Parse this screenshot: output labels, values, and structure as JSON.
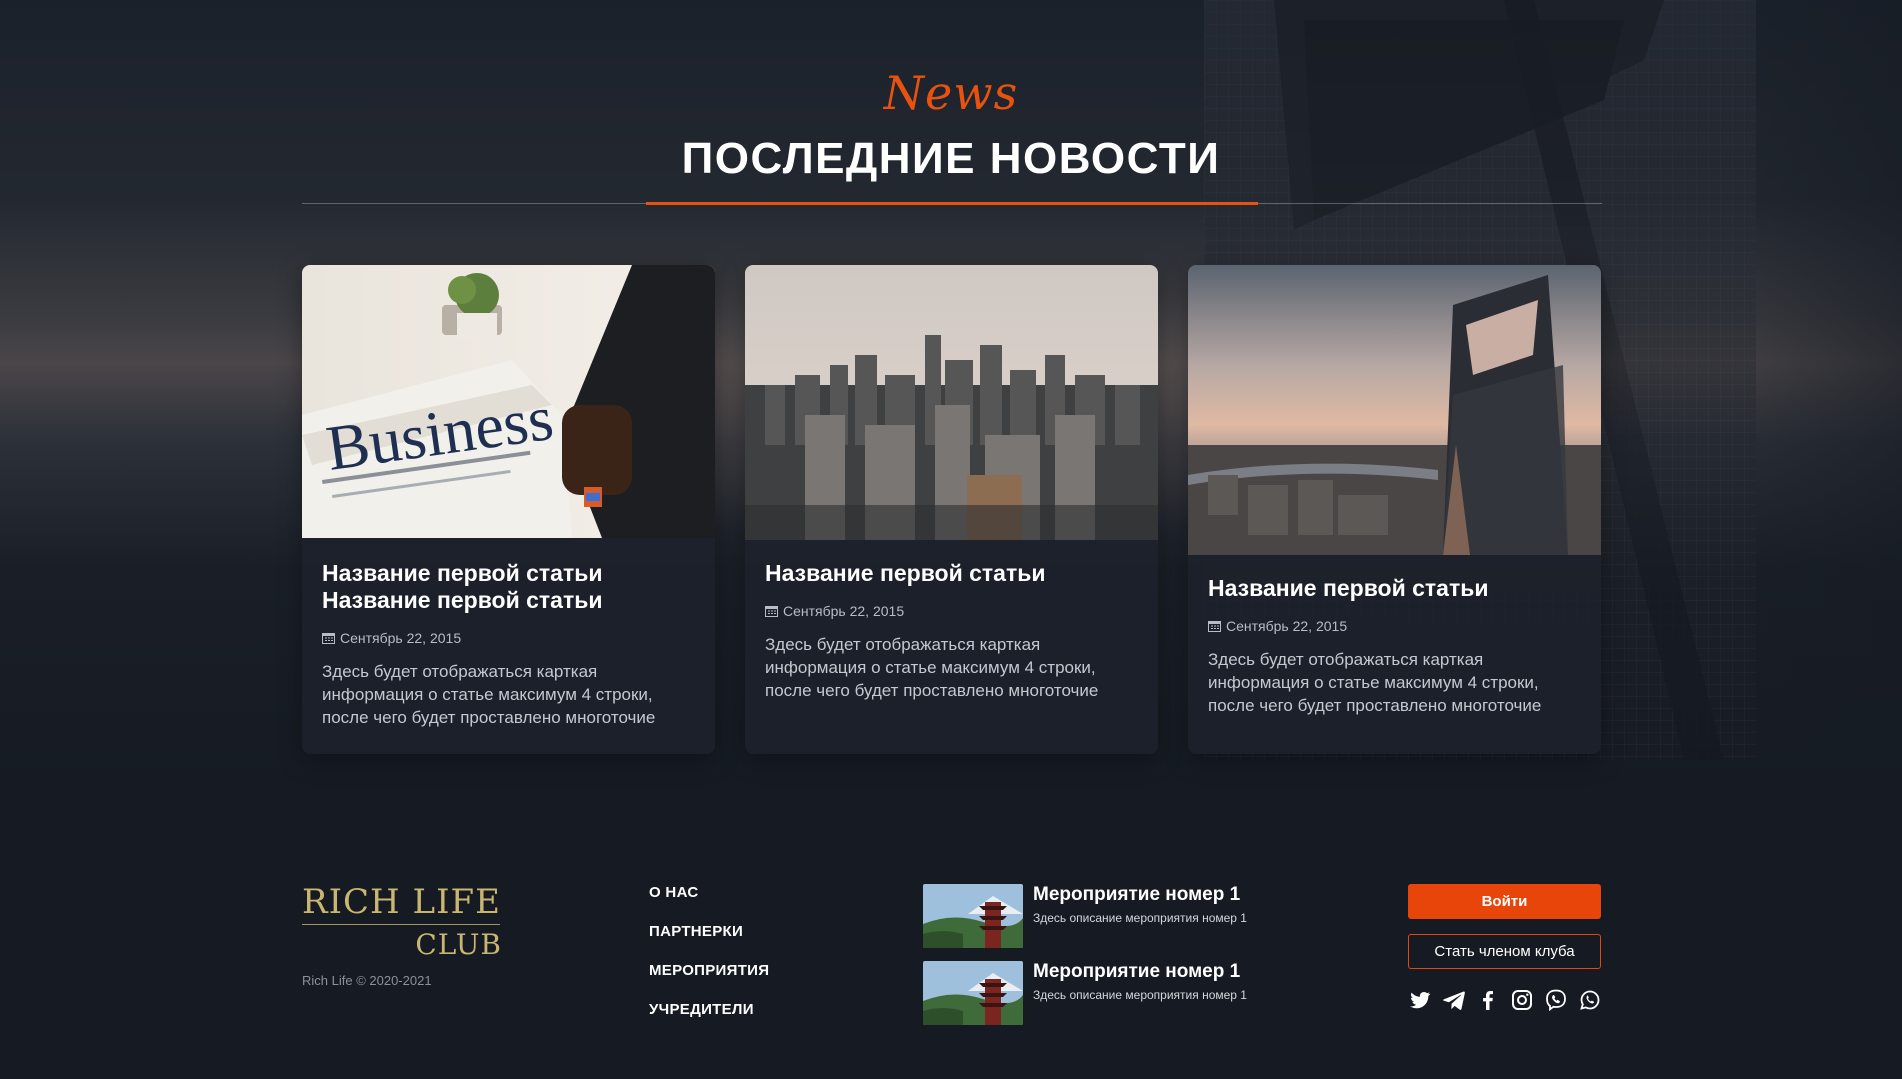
{
  "section": {
    "eyebrow": "News",
    "title": "ПОСЛЕДНИЕ НОВОСТИ"
  },
  "colors": {
    "accent": "#e8520f",
    "background": "#161b23",
    "logo_gold": "#c9b670"
  },
  "news": [
    {
      "title": "Название первой статьи Название первой статьи",
      "date": "Сентябрь 22, 2015",
      "excerpt": "Здесь будет отображаться карткая информация о статье максимум 4 строки, после чего будет проставлено многоточие",
      "image": "business-newspaper"
    },
    {
      "title": "Название первой статьи",
      "date": "Сентябрь 22, 2015",
      "excerpt": "Здесь будет отображаться карткая информация о статье максимум 4 строки, после чего будет проставлено многоточие",
      "image": "city-skyline"
    },
    {
      "title": "Название первой статьи",
      "date": "Сентябрь 22, 2015",
      "excerpt": "Здесь будет отображаться карткая информация о статье максимум 4 строки, после чего будет проставлено многоточие",
      "image": "skyscraper-tower"
    }
  ],
  "footer": {
    "logo_line1": "RICH LIFE",
    "logo_line2": "CLUB",
    "copyright": "Rich Life © 2020-2021",
    "nav": [
      "О НАС",
      "ПАРТНЕРКИ",
      "МЕРОПРИЯТИЯ",
      "УЧРЕДИТЕЛИ"
    ],
    "events": [
      {
        "title": "Мероприятие номер 1",
        "description": "Здесь описание мероприятия номер 1",
        "image": "pagoda-mountain"
      },
      {
        "title": "Мероприятие номер 1",
        "description": "Здесь описание мероприятия номер 1",
        "image": "pagoda-mountain"
      }
    ],
    "login_label": "Войти",
    "join_label": "Стать членом клуба",
    "socials": [
      "twitter-icon",
      "telegram-icon",
      "facebook-icon",
      "instagram-icon",
      "viber-icon",
      "whatsapp-icon"
    ]
  }
}
